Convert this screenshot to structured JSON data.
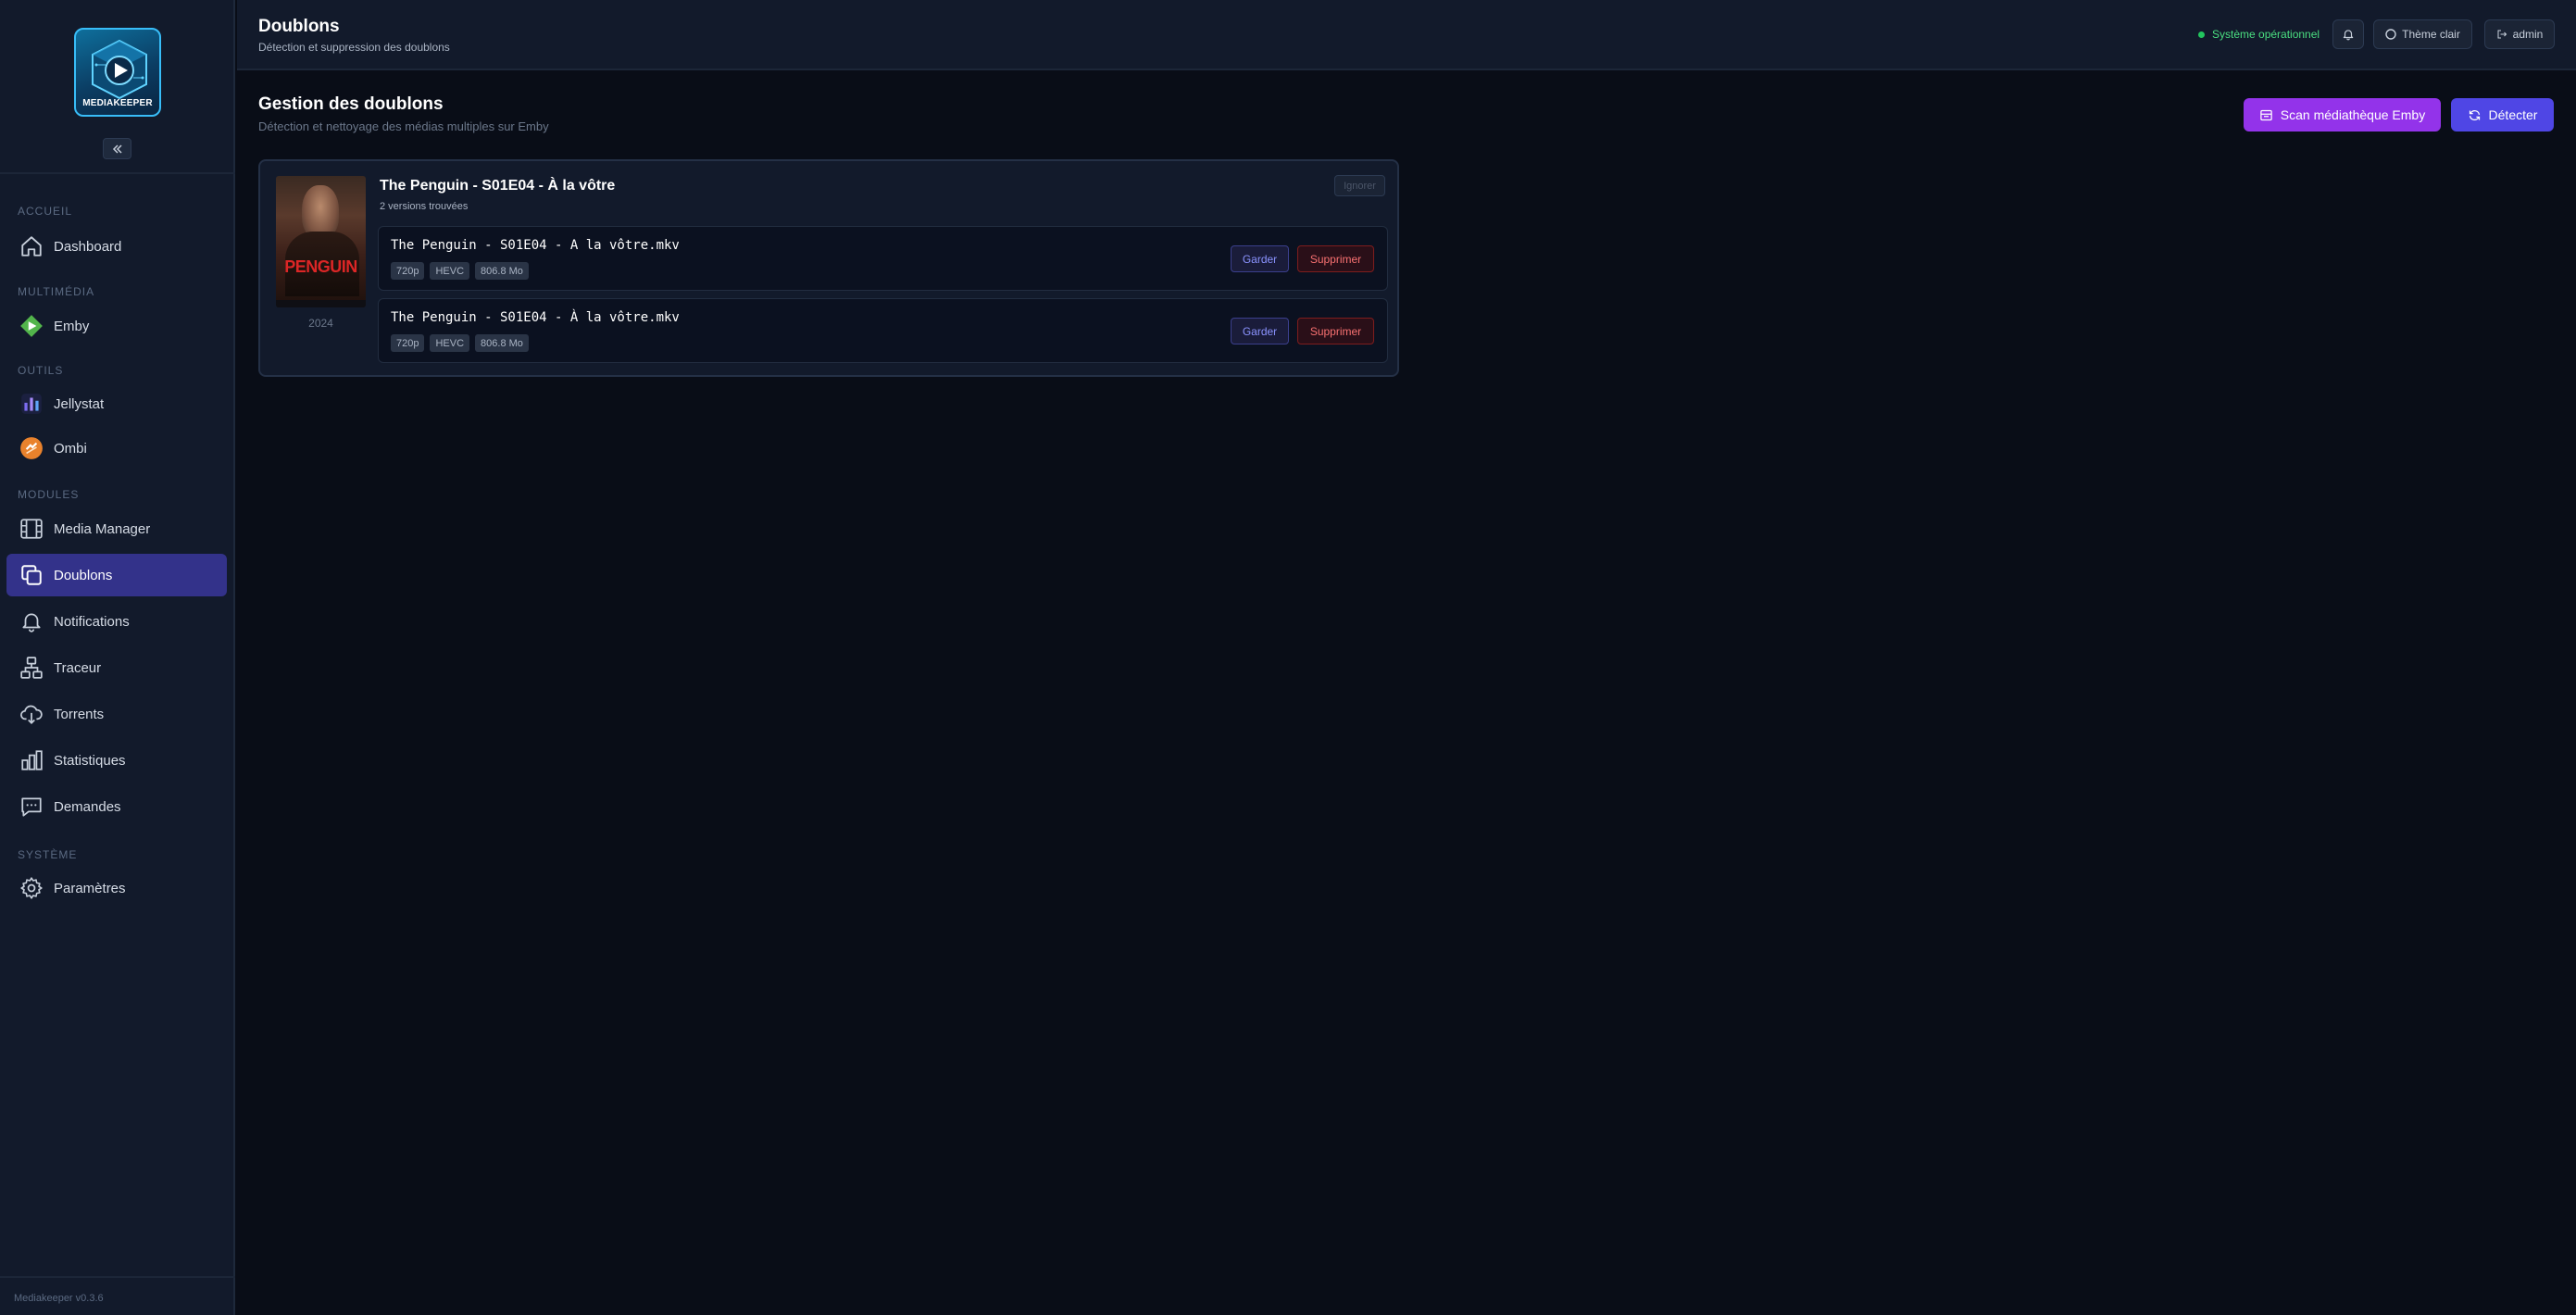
{
  "app": {
    "logo_text": "MEDIAKEEPER",
    "version": "Mediakeeper v0.3.6"
  },
  "sidebar": {
    "sections": [
      {
        "label": "ACCUEIL",
        "items": [
          {
            "label": "Dashboard",
            "icon": "home-icon"
          }
        ]
      },
      {
        "label": "MULTIMÉDIA",
        "items": [
          {
            "label": "Emby",
            "icon": "emby-icon"
          }
        ]
      },
      {
        "label": "OUTILS",
        "items": [
          {
            "label": "Jellystat",
            "icon": "jellystat-icon"
          },
          {
            "label": "Ombi",
            "icon": "ombi-icon"
          }
        ]
      },
      {
        "label": "MODULES",
        "items": [
          {
            "label": "Media Manager",
            "icon": "film-icon"
          },
          {
            "label": "Doublons",
            "icon": "copy-icon",
            "active": true
          },
          {
            "label": "Notifications",
            "icon": "bell-icon"
          },
          {
            "label": "Traceur",
            "icon": "network-icon"
          },
          {
            "label": "Torrents",
            "icon": "cloud-download-icon"
          },
          {
            "label": "Statistiques",
            "icon": "bar-chart-icon"
          },
          {
            "label": "Demandes",
            "icon": "message-icon"
          }
        ]
      },
      {
        "label": "SYSTÈME",
        "items": [
          {
            "label": "Paramètres",
            "icon": "gear-icon"
          }
        ]
      }
    ]
  },
  "header": {
    "title": "Doublons",
    "subtitle": "Détection et suppression des doublons",
    "status": "Système opérationnel",
    "theme_label": "Thème clair",
    "user_label": "admin"
  },
  "main": {
    "title": "Gestion des doublons",
    "subtitle": "Détection et nettoyage des médias multiples sur Emby",
    "scan_label": "Scan médiathèque Emby",
    "detect_label": "Détecter"
  },
  "group": {
    "title": "The Penguin - S01E04 - À la vôtre",
    "count": "2 versions trouvées",
    "year": "2024",
    "poster_word": "PENGUIN",
    "ignore_label": "Ignorer",
    "versions": [
      {
        "file": "The Penguin - S01E04 - A la vôtre.mkv",
        "badges": [
          "720p",
          "HEVC",
          "806.8 Mo"
        ],
        "keep": "Garder",
        "delete": "Supprimer"
      },
      {
        "file": "The Penguin - S01E04 - À la vôtre.mkv",
        "badges": [
          "720p",
          "HEVC",
          "806.8 Mo"
        ],
        "keep": "Garder",
        "delete": "Supprimer"
      }
    ]
  },
  "colors": {
    "accent": "#4f46e5",
    "scan": "#9333ea",
    "active_nav": "#33328a",
    "status": "#22c55e",
    "danger": "#f87171"
  }
}
